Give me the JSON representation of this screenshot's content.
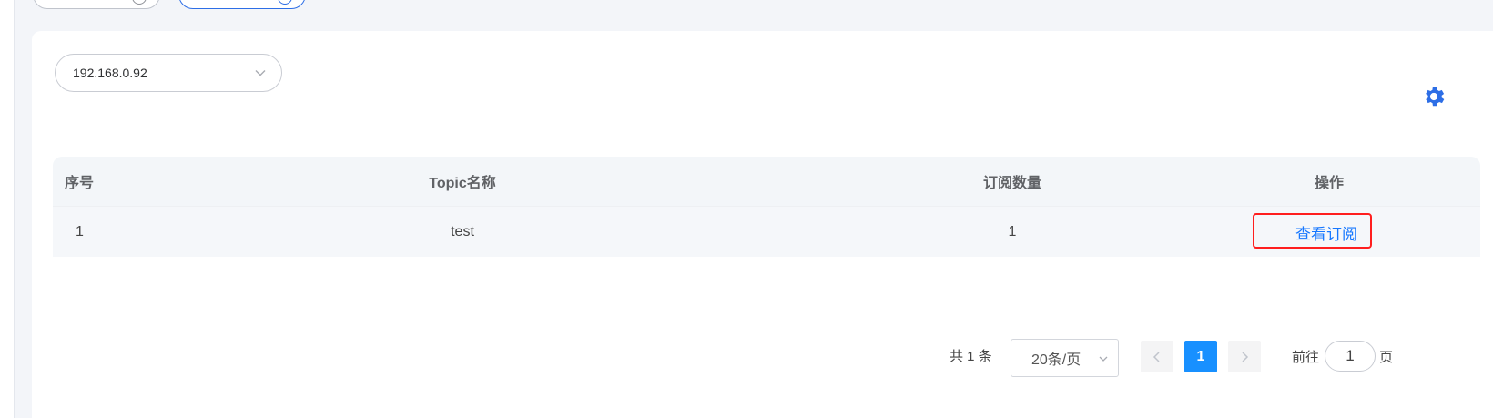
{
  "ip_select": {
    "value": "192.168.0.92"
  },
  "table": {
    "headers": {
      "index": "序号",
      "topic": "Topic名称",
      "count": "订阅数量",
      "action": "操作"
    },
    "rows": [
      {
        "index": "1",
        "topic": "test",
        "count": "1",
        "action": "查看订阅"
      }
    ]
  },
  "pagination": {
    "total": "共 1 条",
    "page_size": "20条/页",
    "current_page": "1",
    "goto_label": "前往",
    "goto_value": "1",
    "goto_suffix": "页"
  },
  "colors": {
    "primary": "#1890ff",
    "link": "#1677ff",
    "highlight": "#ff1e1e",
    "gear": "#2d6ee6"
  }
}
